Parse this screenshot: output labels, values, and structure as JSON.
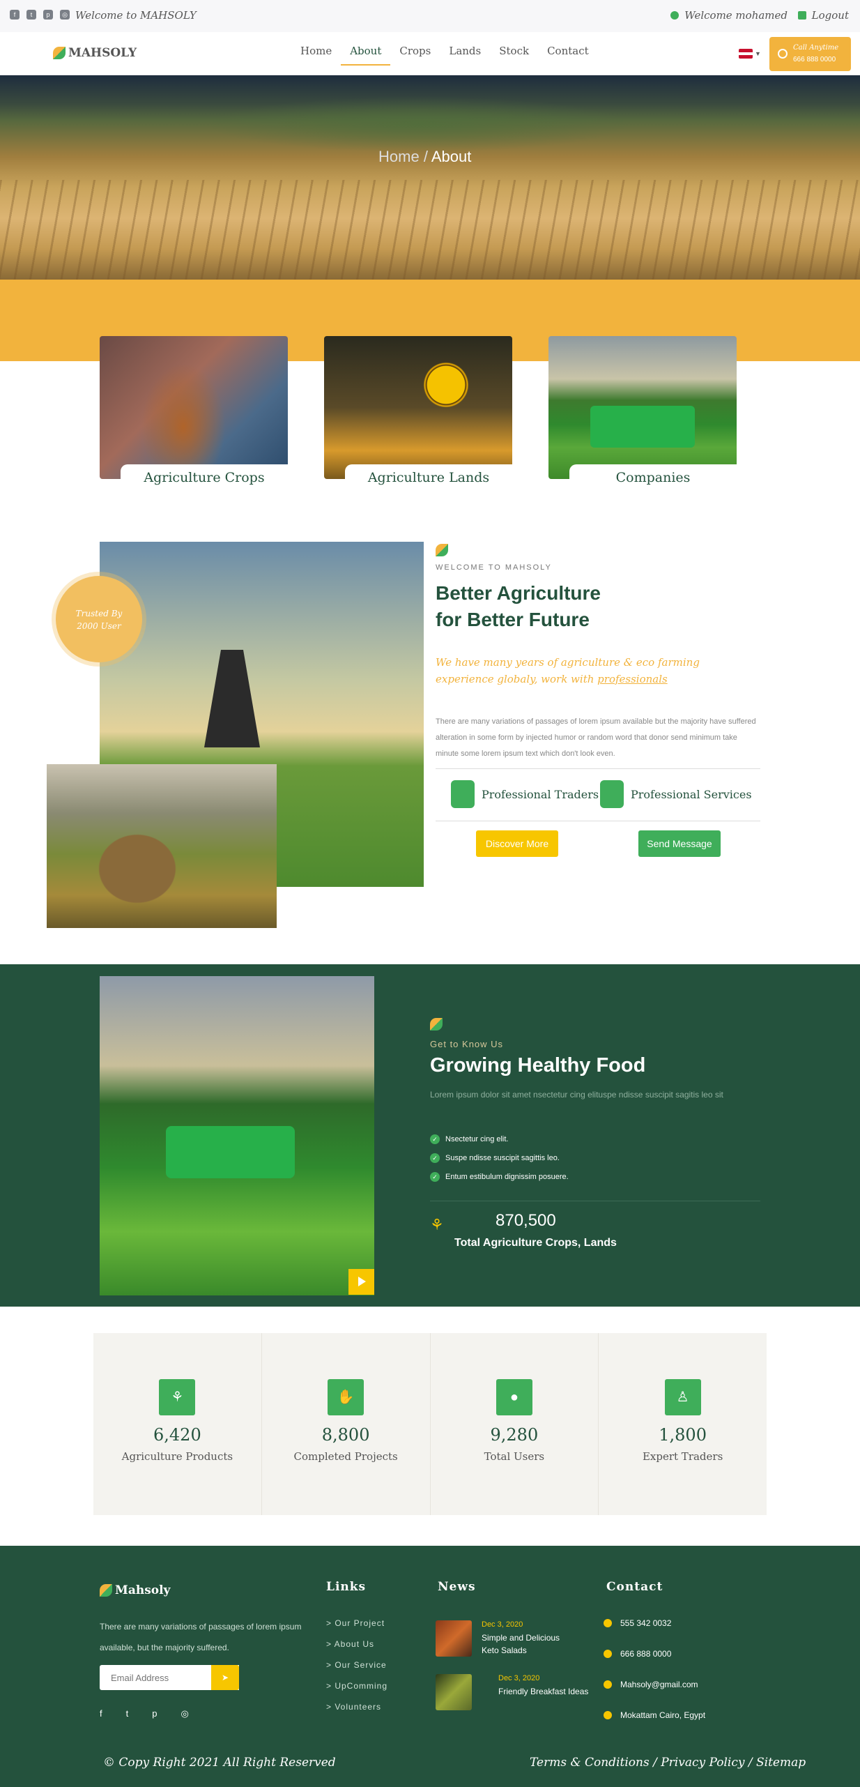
{
  "topbar": {
    "social": [
      "facebook-icon",
      "twitter-icon",
      "pinterest-icon",
      "instagram-icon"
    ],
    "welcome": "Welcome to MAHSOLY",
    "user": "Welcome mohamed",
    "logout": "Logout"
  },
  "nav": {
    "brand": "MAHSOLY",
    "links": [
      "Home",
      "About",
      "Crops",
      "Lands",
      "Stock",
      "Contact"
    ],
    "active": "About",
    "call_label": "Call Anytime",
    "call_number": "666 888 0000"
  },
  "hero": {
    "crumb_home": "Home",
    "crumb_sep": "/",
    "crumb_current": "About"
  },
  "categories": [
    {
      "label": "Agriculture Crops"
    },
    {
      "label": "Agriculture Lands"
    },
    {
      "label": "Companies"
    }
  ],
  "about": {
    "badge_line1": "Trusted By",
    "badge_line2": "2000 User",
    "eyebrow": "WELCOME TO MAHSOLY",
    "title_line1": "Better Agriculture",
    "title_line2": "for Better Future",
    "quote": "We have many years of agriculture & eco farming experience globaly, work with",
    "quote_link": "professionals",
    "paragraph": "There are many variations of passages of lorem ipsum available but the majority have suffered alteration in some form by injected humor or random word that donor send minimum take minute some lorem ipsum text which don't look even.",
    "feature1": "Professional Traders",
    "feature2": "Professional Services",
    "discover": "Discover More",
    "send": "Send Message"
  },
  "growing": {
    "eyebrow": "Get to Know Us",
    "title": "Growing Healthy Food",
    "paragraph": "Lorem ipsum dolor sit amet nsectetur cing elituspe ndisse suscipit sagitis leo sit",
    "list": [
      "Nsectetur cing elit.",
      "Suspe ndisse suscipit sagittis leo.",
      "Entum estibulum dignissim posuere."
    ],
    "number": "870,500",
    "number_label": "Total Agriculture Crops, Lands"
  },
  "stats": [
    {
      "icon": "sprout-icon",
      "value": "6,420",
      "label": "Agriculture Products"
    },
    {
      "icon": "handshake-icon",
      "value": "8,800",
      "label": "Completed Projects"
    },
    {
      "icon": "user-icon",
      "value": "9,280",
      "label": "Total Users"
    },
    {
      "icon": "farmer-icon",
      "value": "1,800",
      "label": "Expert Traders"
    }
  ],
  "footer": {
    "brand": "Mahsoly",
    "about": "There are many variations of passages of lorem ipsum available, but the majority suffered.",
    "email_placeholder": "Email Address",
    "social": [
      "facebook-icon",
      "twitter-icon",
      "pinterest-icon",
      "instagram-icon"
    ],
    "links_title": "Links",
    "links": [
      "> Our Project",
      "> About Us",
      "> Our Service",
      "> UpComming",
      "> Volunteers"
    ],
    "news_title": "News",
    "news": [
      {
        "date": "Dec 3, 2020",
        "title": "Simple and Delicious Keto Salads"
      },
      {
        "date": "Dec 3, 2020",
        "title": "Friendly Breakfast Ideas"
      }
    ],
    "contact_title": "Contact",
    "contact": [
      "555 342 0032",
      "666 888 0000",
      "Mahsoly@gmail.com",
      "Mokattam Cairo, Egypt"
    ],
    "copyright": "© Copy Right 2021 All Right Reserved",
    "legal": "Terms & Conditions / Privacy Policy / Sitemap"
  },
  "colors": {
    "green": "#24523d",
    "accent": "#f2b33d",
    "bright_green": "#3fae5a",
    "yellow": "#f7c600"
  }
}
